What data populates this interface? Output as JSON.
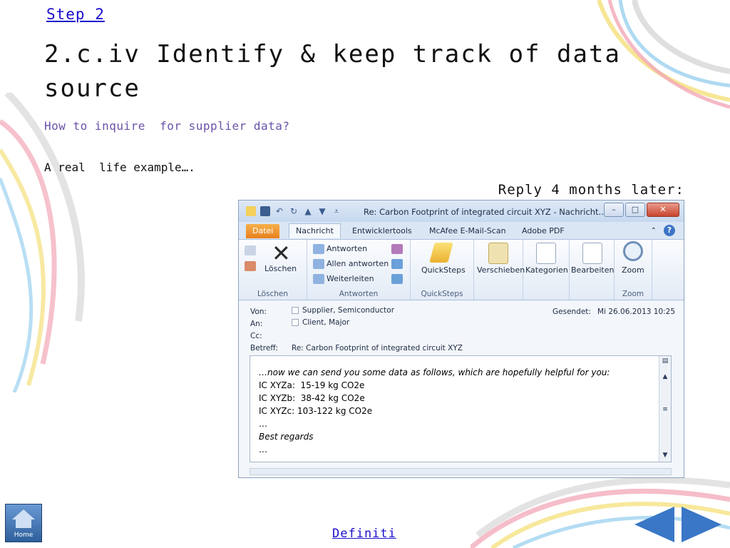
{
  "slide": {
    "step_link": "Step 2",
    "title": "2.c.iv Identify & keep track of data source",
    "subtitle": "How to inquire  for supplier data?",
    "example_text": "A real  life example….",
    "reply_text": "Reply 4 months later:",
    "definition_link": "Definiti",
    "home_label": "Home"
  },
  "email_window": {
    "window_title": "Re: Carbon Footprint of integrated circuit XYZ  -  Nachricht...",
    "tabs": [
      "Datei",
      "Nachricht",
      "Entwicklertools",
      "McAfee E-Mail-Scan",
      "Adobe PDF"
    ],
    "ribbon": {
      "delete_label": "Löschen",
      "group_delete": "Löschen",
      "reply": "Antworten",
      "reply_all": "Allen antworten",
      "forward": "Weiterleiten",
      "group_respond": "Antworten",
      "quicksteps": "QuickSteps",
      "group_quicksteps": "QuickSteps",
      "move": "Verschieben",
      "categories": "Kategorien",
      "edit": "Bearbeiten",
      "zoom": "Zoom",
      "group_zoom": "Zoom"
    },
    "headers": {
      "from_label": "Von:",
      "from_value": "Supplier, Semiconductor",
      "to_label": "An:",
      "to_value": "Client, Major",
      "cc_label": "Cc:",
      "subject_label": "Betreff:",
      "subject_value": "Re: Carbon Footprint of integrated circuit XYZ",
      "sent_label": "Gesendet:",
      "sent_value": "Mi 26.06.2013 10:25"
    },
    "body_lines": [
      "…now we can send you some data as follows, which are hopefully helpful for you:",
      "IC XYZa:  15-19 kg CO2e",
      "IC XYZb:  38-42 kg CO2e",
      "IC XYZc: 103-122 kg CO2e",
      "…",
      "Best regards",
      "…"
    ]
  }
}
